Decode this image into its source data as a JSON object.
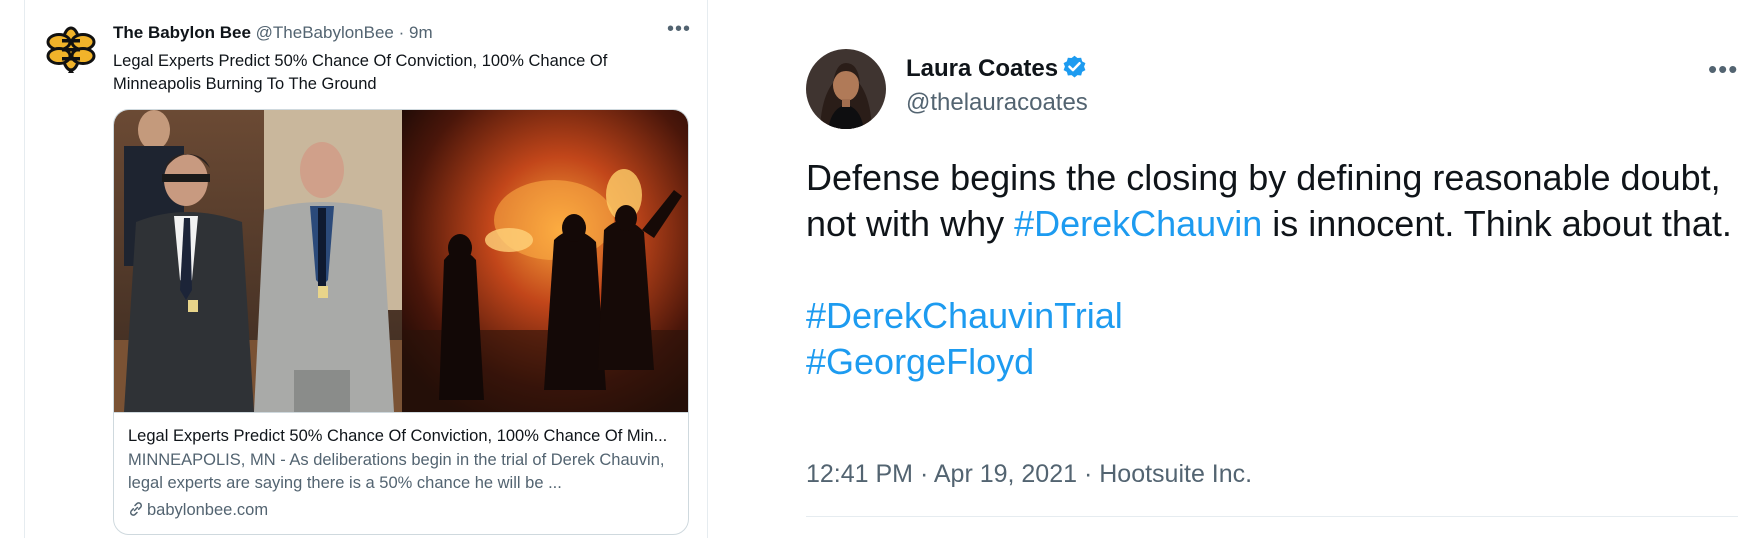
{
  "left_tweet": {
    "display_name": "The Babylon Bee",
    "handle": "@TheBabylonBee",
    "separator": "·",
    "time": "9m",
    "more_icon": "more-icon",
    "text": "Legal Experts Predict 50% Chance Of Conviction, 100% Chance Of Minneapolis Burning To The Ground",
    "card": {
      "title": "Legal Experts Predict 50% Chance Of Conviction, 100% Chance Of Min...",
      "description": "MINNEAPOLIS, MN - As deliberations begin in the trial of Derek Chauvin, legal experts are saying there is a 50% chance he will be ...",
      "domain": "babylonbee.com",
      "link_icon": "link-icon"
    }
  },
  "right_tweet": {
    "display_name": "Laura Coates",
    "handle": "@thelauracoates",
    "verified_icon": "verified-badge-icon",
    "more_icon": "more-icon",
    "text_before": "Defense begins the closing by defining reasonable doubt, not with why ",
    "hashtag_inline": "#DerekChauvin",
    "text_after": " is innocent. Think about that.",
    "hashtag_1": "#DerekChauvinTrial",
    "hashtag_2": "#GeorgeFloyd",
    "time": "12:41 PM",
    "date": "Apr 19, 2021",
    "source": "Hootsuite Inc.",
    "separator": " · "
  },
  "colors": {
    "link_blue": "#1d9bf0",
    "secondary_text": "#536471",
    "primary_text": "#0f1419",
    "border": "#cfd9de"
  }
}
